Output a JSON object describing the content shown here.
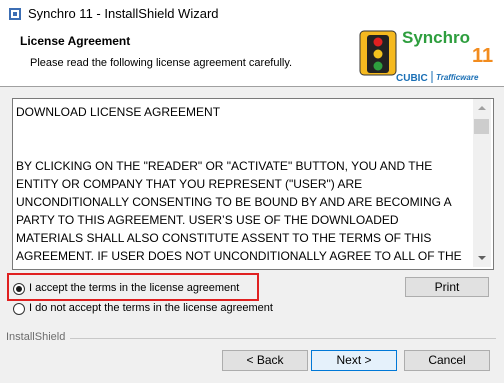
{
  "window": {
    "title": "Synchro 11 - InstallShield Wizard"
  },
  "header": {
    "title": "License Agreement",
    "subtitle": "Please read the following license agreement carefully.",
    "logo": {
      "product": "Synchro",
      "version": "11",
      "brand": "CUBIC",
      "sub_brand": "Trafficware"
    }
  },
  "license": {
    "text": "DOWNLOAD LICENSE AGREEMENT\n\n\nBY CLICKING ON THE \"READER\" OR \"ACTIVATE\" BUTTON, YOU AND THE ENTITY OR COMPANY THAT YOU REPRESENT (\"USER\") ARE UNCONDITIONALLY CONSENTING TO BE BOUND BY AND ARE BECOMING A PARTY TO THIS AGREEMENT. USER’S USE OF THE DOWNLOADED MATERIALS SHALL ALSO CONSTITUTE ASSENT TO THE TERMS OF THIS AGREEMENT. IF USER DOES NOT UNCONDITIONALLY AGREE TO ALL OF THE"
  },
  "options": {
    "accept_label": "I accept the terms in the license agreement",
    "decline_label": "I do not accept the terms in the license agreement",
    "selected": "accept"
  },
  "buttons": {
    "print": "Print",
    "back": "< Back",
    "next": "Next >",
    "cancel": "Cancel"
  },
  "footer": {
    "installshield_label": "InstallShield"
  },
  "colors": {
    "highlight": "#e02020",
    "logo_green": "#2e9e3e",
    "logo_orange": "#f28c1e",
    "logo_blue": "#1a6fb5"
  }
}
